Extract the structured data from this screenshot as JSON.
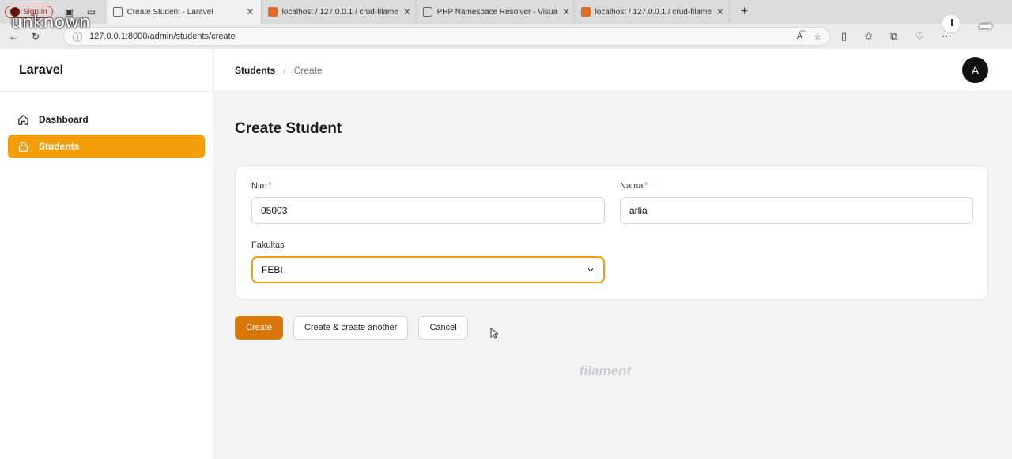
{
  "overlay": {
    "title": "unknown"
  },
  "browser": {
    "signin_label": "Sign in",
    "tabs": [
      {
        "title": "Create Student - Laravel",
        "color": "#888888"
      },
      {
        "title": "localhost / 127.0.0.1 / crud-filame",
        "color": "#e06b2a"
      },
      {
        "title": "PHP Namespace Resolver - Visua",
        "color": "#888888"
      },
      {
        "title": "localhost / 127.0.0.1 / crud-filame",
        "color": "#e06b2a"
      }
    ],
    "url": "127.0.0.1:8000/admin/students/create"
  },
  "sidebar": {
    "brand": "Laravel",
    "items": [
      {
        "label": "Dashboard",
        "icon": "home-icon",
        "active": false
      },
      {
        "label": "Students",
        "icon": "lock-icon",
        "active": true
      }
    ]
  },
  "topbar": {
    "breadcrumb": [
      "Students",
      "Create"
    ],
    "avatar_initial": "A"
  },
  "main": {
    "title": "Create Student",
    "form": {
      "nim": {
        "label": "Nim",
        "value": "05003",
        "required": true
      },
      "nama": {
        "label": "Nama",
        "value": "arlia",
        "required": true
      },
      "fakultas": {
        "label": "Fakultas",
        "value": "FEBI"
      }
    },
    "actions": {
      "create": "Create",
      "create_another": "Create & create another",
      "cancel": "Cancel"
    },
    "footer": "filament"
  },
  "colors": {
    "accent": "#f59e0b",
    "primary_button": "#d97706"
  }
}
